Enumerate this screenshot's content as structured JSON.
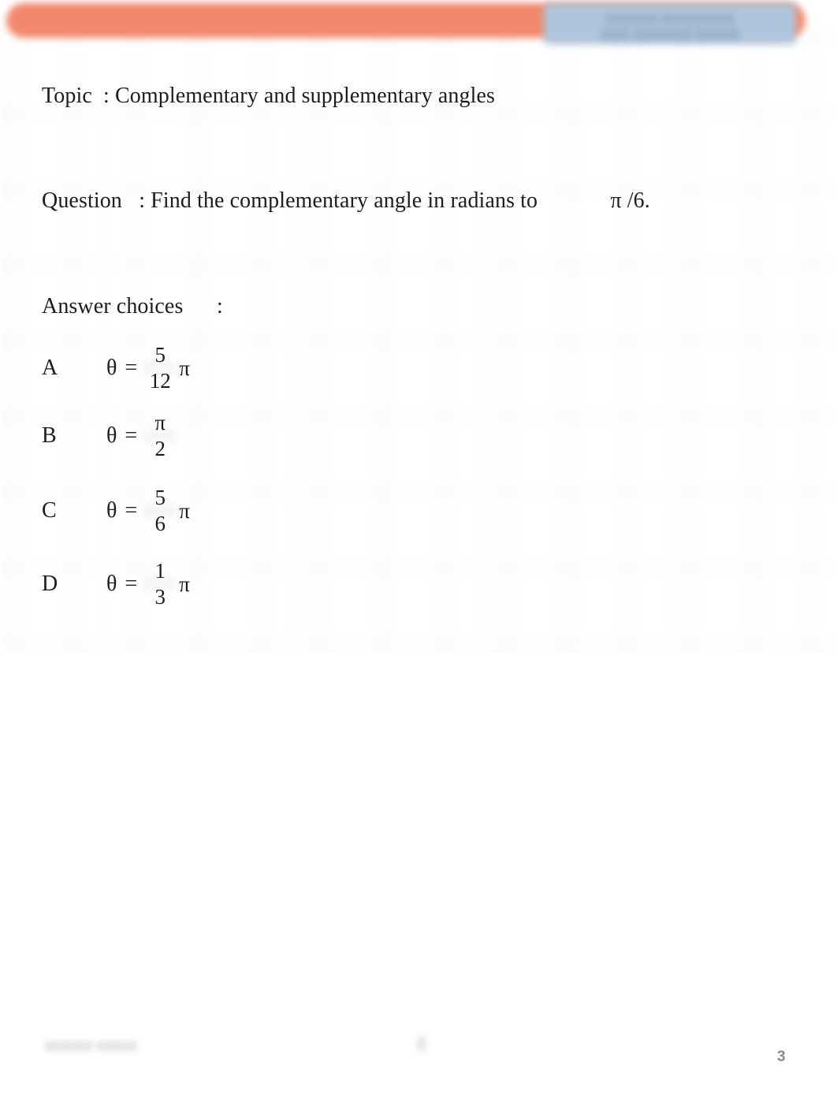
{
  "document": {
    "page_number": "3",
    "accent_color_bar": "#f2886b",
    "accent_color_chip": "#aec6dc"
  },
  "header": {
    "chip_label": "▮▮▮▮▮▮▮ ▮▮▮▮▮▮▮▮▮▮\n▮▮▮▮ ▮▮▮▮▮▮▮▮ ▮▮▮▮▮▮"
  },
  "content": {
    "topic_line": "Topic  : Complementary and supplementary angles",
    "question_line": "Question   : Find the complementary angle in radians to             π /6.",
    "answers_label": "Answer choices      :",
    "choices": [
      {
        "letter": "A",
        "theta": "θ",
        "equals": "=",
        "numerator": "5",
        "denominator": "12",
        "suffix": "π"
      },
      {
        "letter": "B",
        "theta": "θ",
        "equals": "=",
        "numerator": "π",
        "denominator": "2",
        "suffix": ""
      },
      {
        "letter": "C",
        "theta": "θ",
        "equals": "=",
        "numerator": "5",
        "denominator": "6",
        "suffix": "π"
      },
      {
        "letter": "D",
        "theta": "θ",
        "equals": "=",
        "numerator": "1",
        "denominator": "3",
        "suffix": "π"
      }
    ]
  },
  "footer": {
    "left_note": "▮▮▮▮▮▮▮ ▮▮▮▮▮▮",
    "center_mark": "▮"
  }
}
